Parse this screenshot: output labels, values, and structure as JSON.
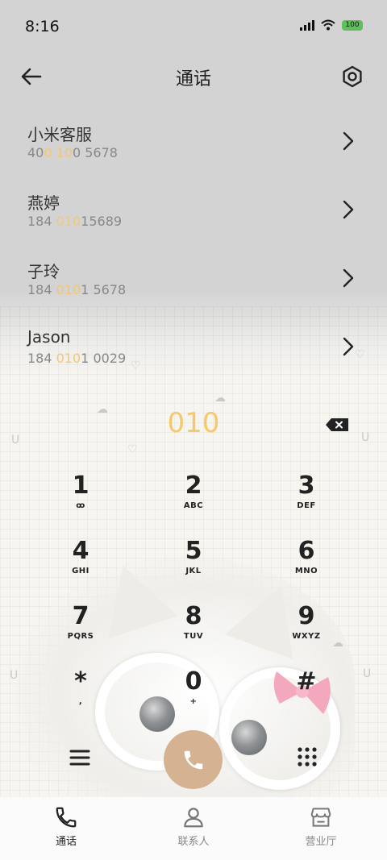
{
  "status_bar": {
    "time": "8:16",
    "battery": "100"
  },
  "header": {
    "title": "通话"
  },
  "results": [
    {
      "name": "小米客服",
      "number": [
        {
          "t": "40",
          "hl": false
        },
        {
          "t": "0 10",
          "hl": true
        },
        {
          "t": "0 5678",
          "hl": false
        }
      ]
    },
    {
      "name": "燕婷",
      "number": [
        {
          "t": "184 ",
          "hl": false
        },
        {
          "t": "010",
          "hl": true
        },
        {
          "t": "15689",
          "hl": false
        }
      ]
    },
    {
      "name": "子玲",
      "number": [
        {
          "t": "184 ",
          "hl": false
        },
        {
          "t": "010",
          "hl": true
        },
        {
          "t": "1 5678",
          "hl": false
        }
      ]
    },
    {
      "name": "Jason",
      "number": [
        {
          "t": "184 ",
          "hl": false
        },
        {
          "t": "010",
          "hl": true
        },
        {
          "t": "1 0029",
          "hl": false
        }
      ]
    }
  ],
  "dialed": "010",
  "keypad": [
    {
      "digit": "1",
      "letters": "ꝏ"
    },
    {
      "digit": "2",
      "letters": "ABC"
    },
    {
      "digit": "3",
      "letters": "DEF"
    },
    {
      "digit": "4",
      "letters": "GHI"
    },
    {
      "digit": "5",
      "letters": "JKL"
    },
    {
      "digit": "6",
      "letters": "MNO"
    },
    {
      "digit": "7",
      "letters": "PQRS"
    },
    {
      "digit": "8",
      "letters": "TUV"
    },
    {
      "digit": "9",
      "letters": "WXYZ"
    },
    {
      "digit": "*",
      "letters": ","
    },
    {
      "digit": "0",
      "letters": "+"
    },
    {
      "digit": "#",
      "letters": ""
    }
  ],
  "tabs": [
    {
      "label": "通话",
      "icon": "phone-icon",
      "active": true
    },
    {
      "label": "联系人",
      "icon": "person-icon",
      "active": false
    },
    {
      "label": "营业厅",
      "icon": "store-icon",
      "active": false
    }
  ],
  "colors": {
    "highlight": "#f5c772",
    "call_button": "#d5b291"
  }
}
